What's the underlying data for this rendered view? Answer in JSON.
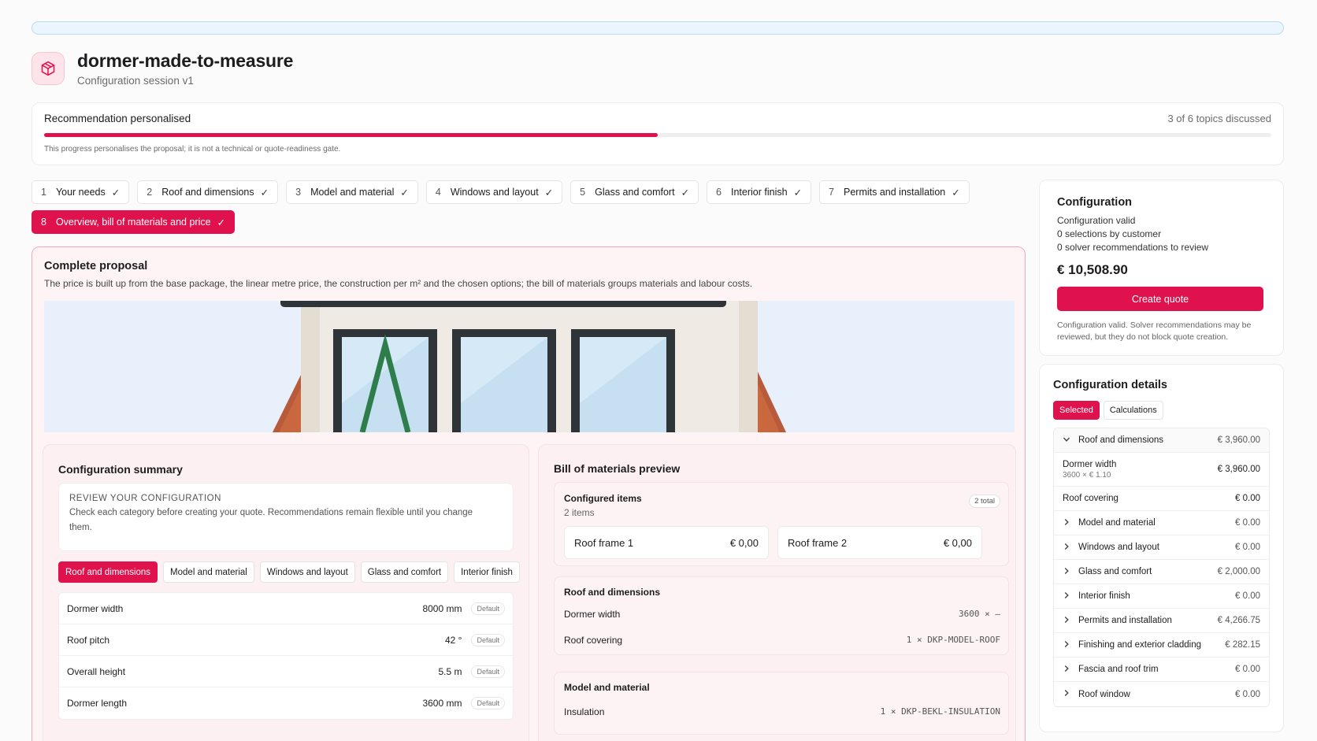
{
  "app": {
    "title": "dormer-made-to-measure",
    "subtitle": "Configuration session v1",
    "icon": "cube-icon",
    "accent_color": "#e0124e"
  },
  "progress": {
    "title": "Recommendation personalised",
    "count": "3 of 6 topics discussed",
    "value": 0.5,
    "note": "This progress personalises the proposal; it is not a technical or quote-readiness gate."
  },
  "steps": [
    {
      "num": "1",
      "label": "Your needs",
      "done": "✓"
    },
    {
      "num": "2",
      "label": "Roof and dimensions",
      "done": "✓"
    },
    {
      "num": "3",
      "label": "Model and material",
      "done": "✓"
    },
    {
      "num": "4",
      "label": "Windows and layout",
      "done": "✓"
    },
    {
      "num": "5",
      "label": "Glass and comfort",
      "done": "✓"
    },
    {
      "num": "6",
      "label": "Interior finish",
      "done": "✓"
    },
    {
      "num": "7",
      "label": "Permits and installation",
      "done": "✓"
    },
    {
      "num": "8",
      "label": "Overview, bill of materials and price",
      "done": "✓"
    }
  ],
  "proposal": {
    "title": "Complete proposal",
    "description": "The price is built up from the base package, the linear metre price, the construction per m² and the chosen options; the bill of materials groups materials and labour costs."
  },
  "summary": {
    "title": "Configuration summary",
    "review_label": "REVIEW YOUR CONFIGURATION",
    "review_text": "Check each category before creating your quote. Recommendations remain flexible until you change them.",
    "tabs": [
      "Roof and dimensions",
      "Model and material",
      "Windows and layout",
      "Glass and comfort",
      "Interior finish"
    ],
    "rows": [
      {
        "label": "Dormer width",
        "value": "8000 mm",
        "badge": "Default"
      },
      {
        "label": "Roof pitch",
        "value": "42 °",
        "badge": "Default"
      },
      {
        "label": "Overall height",
        "value": "5.5 m",
        "badge": "Default"
      },
      {
        "label": "Dormer length",
        "value": "3600 mm",
        "badge": "Default"
      }
    ]
  },
  "bom": {
    "title": "Bill of materials preview",
    "configured_title": "Configured items",
    "configured_sub": "2 items",
    "configured_total": "2 total",
    "frames": [
      {
        "label": "Roof frame 1",
        "price": "€ 0,00"
      },
      {
        "label": "Roof frame 2",
        "price": "€ 0,00"
      }
    ],
    "groups": [
      {
        "title": "Roof and dimensions",
        "rows": [
          {
            "label": "Dormer width",
            "value": "3600 × –"
          },
          {
            "label": "Roof covering",
            "value": "1 × DKP-MODEL-ROOF"
          }
        ]
      },
      {
        "title": "Model and material",
        "rows": [
          {
            "label": "Insulation",
            "value": "1 × DKP-BEKL-INSULATION"
          }
        ]
      }
    ]
  },
  "configuration": {
    "title": "Configuration",
    "lines": [
      "Configuration valid",
      "0 selections by customer",
      "0 solver recommendations to review"
    ],
    "price": "€ 10,508.90",
    "button": "Create quote",
    "note": "Configuration valid. Solver recommendations may be reviewed, but they do not block quote creation."
  },
  "details": {
    "title": "Configuration details",
    "tabs": [
      "Selected",
      "Calculations"
    ],
    "open_category": {
      "label": "Roof and dimensions",
      "amount": "€ 3,960.00"
    },
    "open_rows": [
      {
        "label": "Dormer width",
        "note": "3600 × € 1.10",
        "amount": "€ 3,960.00"
      },
      {
        "label": "Roof covering",
        "note": "",
        "amount": "€ 0.00"
      }
    ],
    "categories": [
      {
        "label": "Model and material",
        "amount": "€ 0.00"
      },
      {
        "label": "Windows and layout",
        "amount": "€ 0.00"
      },
      {
        "label": "Glass and comfort",
        "amount": "€ 2,000.00"
      },
      {
        "label": "Interior finish",
        "amount": "€ 0.00"
      },
      {
        "label": "Permits and installation",
        "amount": "€ 4,266.75"
      },
      {
        "label": "Finishing and exterior cladding",
        "amount": "€ 282.15"
      },
      {
        "label": "Fascia and roof trim",
        "amount": "€ 0.00"
      },
      {
        "label": "Roof window",
        "amount": "€ 0.00"
      }
    ]
  }
}
